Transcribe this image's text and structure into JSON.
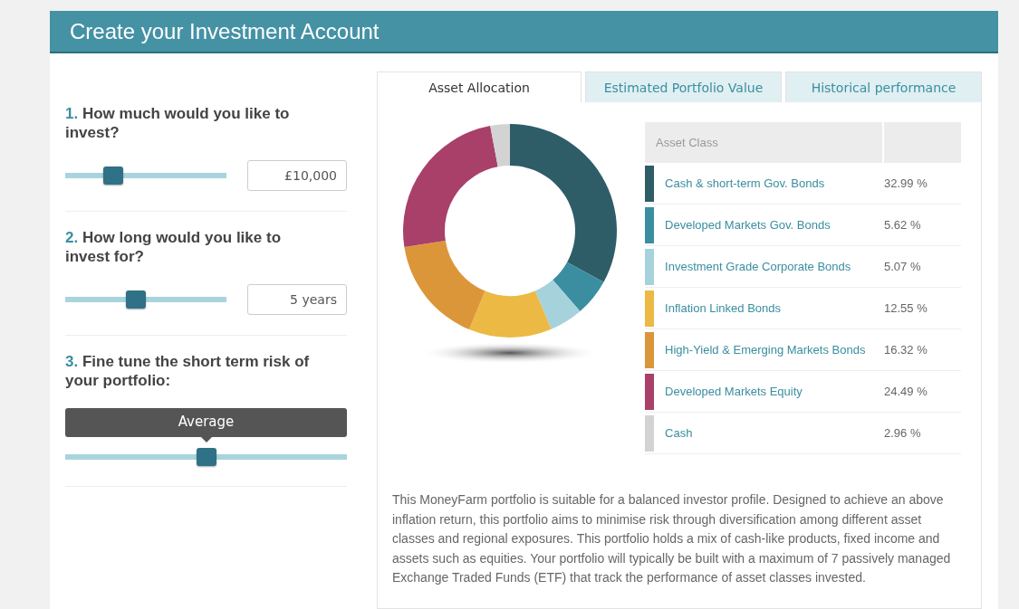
{
  "header": {
    "title": "Create your Investment Account"
  },
  "questions": [
    {
      "number": "1.",
      "text": "How much would you like to invest?",
      "level": 0.3,
      "value": "£10,000",
      "kind": "field"
    },
    {
      "number": "2.",
      "text": "How long would you like to invest for?",
      "level": 0.44,
      "value": "5 years",
      "kind": "field"
    },
    {
      "number": "3.",
      "text": "Fine tune the short term risk of your portfolio:",
      "level": 0.5,
      "tooltip": "Average",
      "kind": "tooltip"
    }
  ],
  "tabs": [
    {
      "label": "Asset Allocation",
      "selected": true
    },
    {
      "label": "Estimated Portfolio Value",
      "selected": false
    },
    {
      "label": "Historical performance",
      "selected": false
    }
  ],
  "chart_data": {
    "type": "donut",
    "categories": [
      "Cash & short-term Gov. Bonds",
      "Developed Markets Gov. Bonds",
      "Investment Grade Corporate Bonds",
      "Inflation Linked Bonds",
      "High-Yield & Emerging Markets Bonds",
      "Developed Markets Equity",
      "Cash"
    ],
    "values": [
      32.99,
      5.62,
      5.07,
      12.55,
      16.32,
      24.49,
      2.96
    ]
  },
  "table": {
    "columns": [
      "Asset Class"
    ],
    "rows": [
      {
        "percent": "32.99 %",
        "color": "#2e5d68"
      },
      {
        "percent": "5.62 %",
        "color": "#3a8ea0"
      },
      {
        "percent": "5.07 %",
        "color": "#a6d2dc"
      },
      {
        "percent": "12.55 %",
        "color": "#ecb944"
      },
      {
        "percent": "16.32 %",
        "color": "#dc963a"
      },
      {
        "percent": "24.49 %",
        "color": "#a8406a"
      },
      {
        "percent": "2.96 %",
        "color": "#d3d3d3"
      }
    ]
  },
  "description": "This MoneyFarm portfolio is suitable for a balanced investor profile. Designed to achieve an above inflation return, this portfolio aims to minimise risk through diversification among different asset classes and regional exposures. This portfolio holds a mix of cash-like products, fixed income and assets such as equities. Your portfolio will typically be built with a maximum of 7 passively managed Exchange Traded Funds (ETF) that track the performance of asset classes invested."
}
